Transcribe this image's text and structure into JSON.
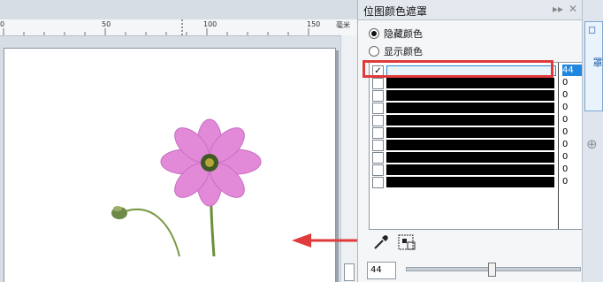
{
  "ruler": {
    "n0": "0",
    "n50": "50",
    "n100": "100",
    "n150": "150",
    "unit": "毫米"
  },
  "panel": {
    "title": "位图颜色遮罩",
    "radio_hide": "隐藏颜色",
    "radio_show": "显示颜色",
    "rows": [
      {
        "checked": "✓",
        "value": "44"
      },
      {
        "checked": "",
        "value": "0"
      },
      {
        "checked": "",
        "value": "0"
      },
      {
        "checked": "",
        "value": "0"
      },
      {
        "checked": "",
        "value": "0"
      },
      {
        "checked": "",
        "value": "0"
      },
      {
        "checked": "",
        "value": "0"
      },
      {
        "checked": "",
        "value": "0"
      },
      {
        "checked": "",
        "value": "0"
      },
      {
        "checked": "",
        "value": "0"
      }
    ],
    "tolerance": "44"
  },
  "side": {
    "tab_label": "位图颜色遮罩"
  },
  "colors": {
    "highlight": "#e03b3b",
    "selected_value_bg": "#1f87e0",
    "swatch": "#000000"
  },
  "icons": [
    "eyedropper-icon",
    "color-grid-icon",
    "add-icon",
    "pin-icon",
    "close-icon"
  ]
}
